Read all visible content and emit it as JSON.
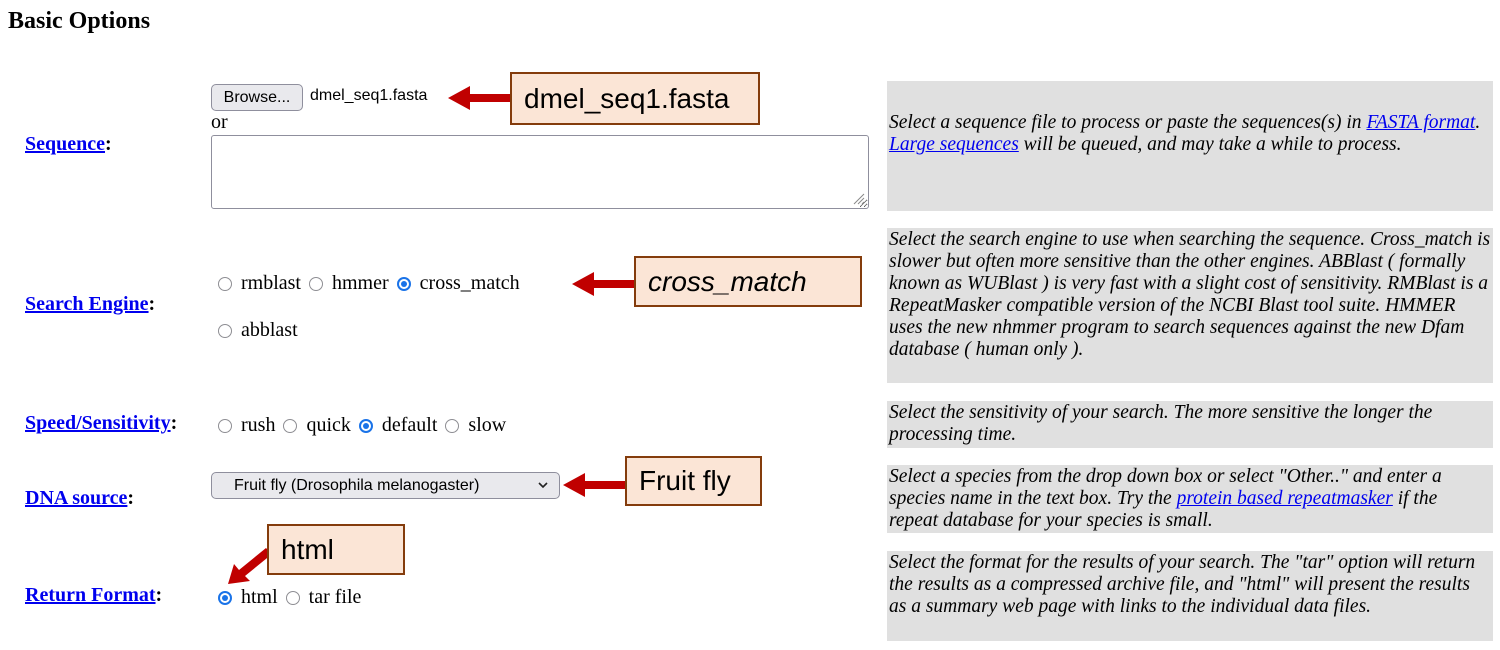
{
  "page": {
    "title": "Basic Options"
  },
  "sequence": {
    "label": "Sequence",
    "colon": ":",
    "browse_label": "Browse...",
    "file_name": "dmel_seq1.fasta",
    "or_text": "or",
    "textarea_value": "",
    "help": {
      "t1": "Select a sequence file to process or paste the sequences(s) in ",
      "link1": "FASTA format",
      "t2": ". ",
      "link2": "Large sequences",
      "t3": " will be queued, and may take a while to process."
    }
  },
  "search_engine": {
    "label": "Search Engine",
    "colon": ":",
    "options": [
      {
        "label": "rmblast",
        "checked": false
      },
      {
        "label": "hmmer",
        "checked": false
      },
      {
        "label": "cross_match",
        "checked": true
      },
      {
        "label": "abblast",
        "checked": false
      }
    ],
    "help": "Select the search engine to use when searching the sequence. Cross_match is slower but often more sensitive than the other engines. ABBlast ( formally known as WUBlast ) is very fast with a slight cost of sensitivity. RMBlast is a RepeatMasker compatible version of the NCBI Blast tool suite. HMMER uses the new nhmmer program to search sequences against the new Dfam database ( human only )."
  },
  "speed": {
    "label": "Speed/Sensitivity",
    "colon": ":",
    "options": [
      {
        "label": "rush",
        "checked": false
      },
      {
        "label": "quick",
        "checked": false
      },
      {
        "label": "default",
        "checked": true
      },
      {
        "label": "slow",
        "checked": false
      }
    ],
    "help": "Select the sensitivity of your search. The more sensitive the longer the processing time."
  },
  "dna_source": {
    "label": "DNA source",
    "colon": ":",
    "selected": "Fruit fly (Drosophila melanogaster)",
    "help": {
      "t1": "Select a species from the drop down box or select \"Other..\" and enter a species name in the text box. Try the ",
      "link1": "protein based repeatmasker",
      "t2": " if the repeat database for your species is small."
    }
  },
  "return_format": {
    "label": "Return Format",
    "colon": ":",
    "options": [
      {
        "label": "html",
        "checked": true
      },
      {
        "label": "tar file",
        "checked": false
      }
    ],
    "help": "Select the format for the results of your search. The \"tar\" option will return the results as a compressed archive file, and \"html\" will present the results as a summary web page with links to the individual data files."
  },
  "annotations": {
    "file_callout": "dmel_seq1.fasta",
    "engine_callout": "cross_match",
    "dna_callout": "Fruit fly",
    "format_callout": "html",
    "arrow_color": "#c00000",
    "callout_bg": "#fbe5d6",
    "callout_border": "#843c0c"
  },
  "colors": {
    "link": "#0000ee",
    "help_bg": "#e0e0e0",
    "radio_checked": "#1a73e8"
  }
}
